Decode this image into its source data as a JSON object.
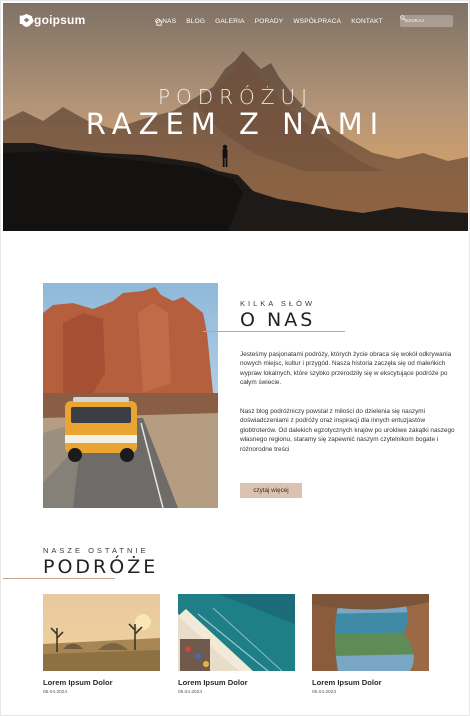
{
  "header": {
    "logo_text": "Logoipsum",
    "nav": [
      "O NAS",
      "BLOG",
      "GALERIA",
      "PORADY",
      "WSPÓŁPRACA",
      "KONTAKT"
    ],
    "search_placeholder": "SZUKAJ"
  },
  "hero": {
    "subtitle": "PODRÓŻUJ",
    "title": "RAZEM Z NAMI"
  },
  "about": {
    "kicker": "KILKA SŁÓW",
    "title": "O NAS",
    "paragraphs": [
      "Jesteśmy pasjonatami podróży, których życie obraca się wokół odkrywania nowych miejsc, kultur i przygód. Nasza historia zaczęła się od małeńkich wypraw lokalnych, które szybko przerodziły się w ekscytujące podróże po całym świecie.",
      "Nasz blog podróżniczy powstał z miłości do dzielenia się naszymi doświadczeniami z podróży oraz inspiracji dla innych entuzjastów globtroterów. Od dalekich egzotycznych krajów po urokliwe zakątki naszego własnego regionu, staramy się zapewnić naszym czytelnikom bogate i różnorodne treści"
    ],
    "button_label": "czytaj więcej"
  },
  "trips": {
    "kicker": "NASZE OSTATNIE",
    "title": "PODRÓŻE",
    "cards": [
      {
        "title": "Lorem Ipsum Dolor",
        "date": "05.04.2024"
      },
      {
        "title": "Lorem Ipsum Dolor",
        "date": "05.04.2024"
      },
      {
        "title": "Lorem Ipsum Dolor",
        "date": "05.04.2024"
      }
    ]
  },
  "colors": {
    "accent": "#c9a48c",
    "button_bg": "#dcc3b1",
    "text": "#2b2b2b"
  }
}
